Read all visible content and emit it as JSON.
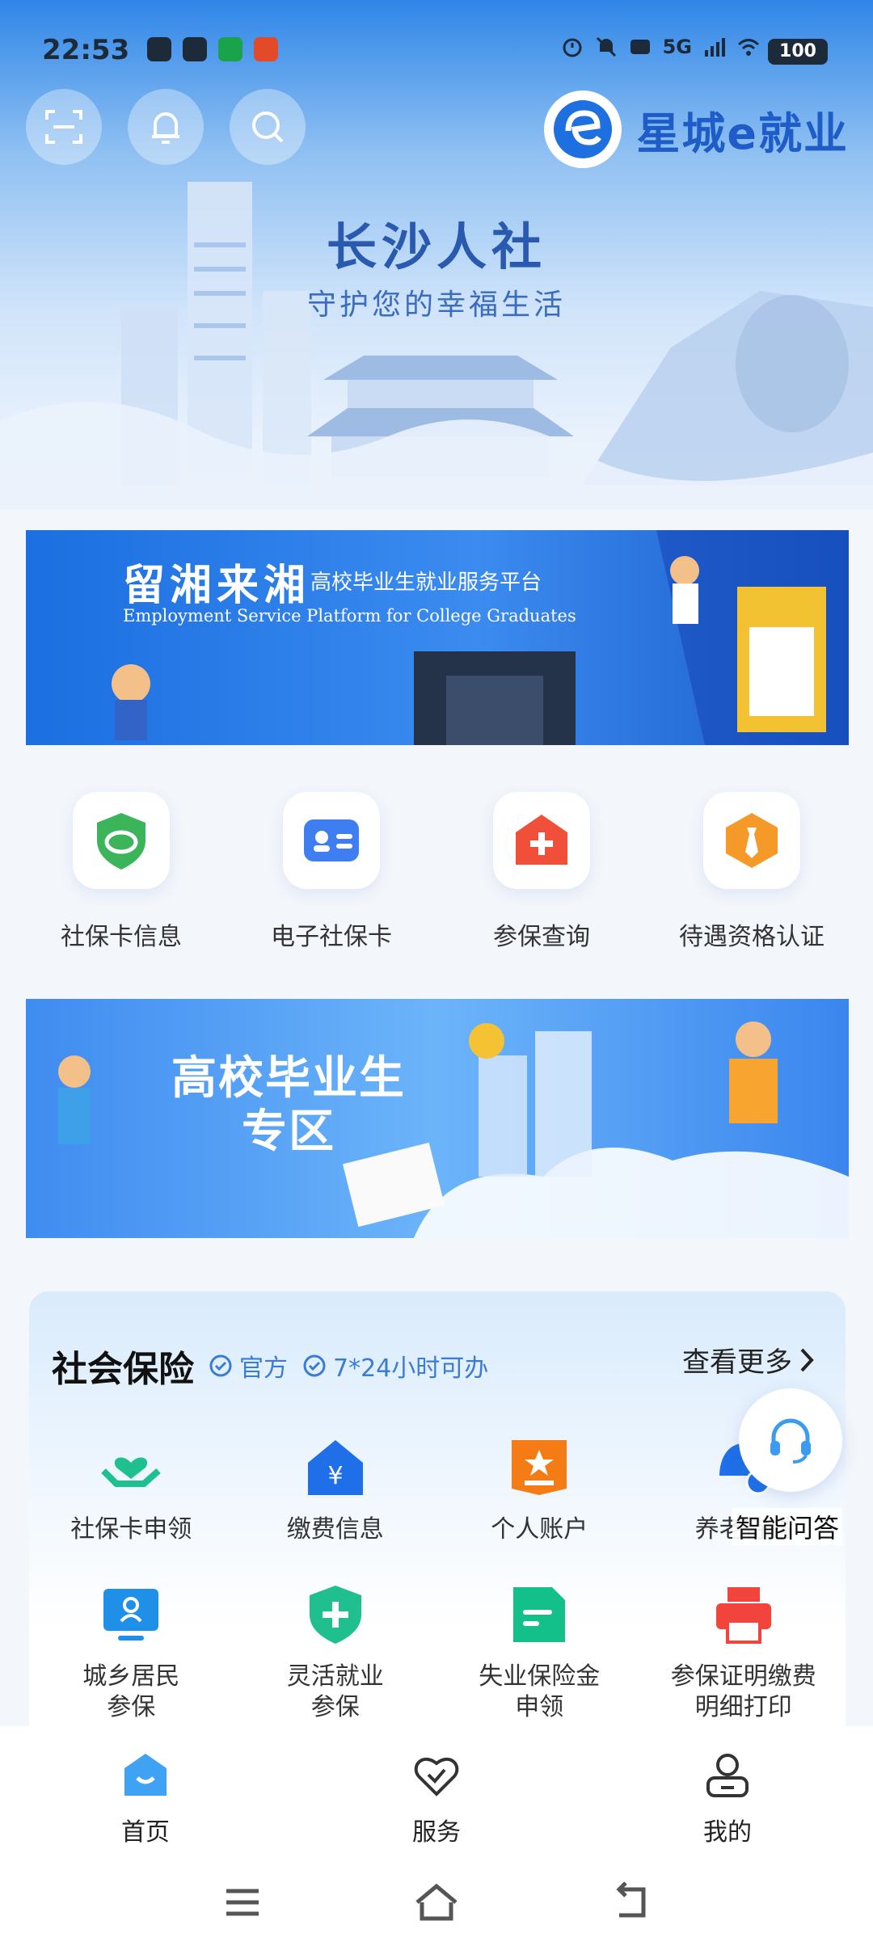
{
  "status_bar": {
    "time": "22:53",
    "network": "5G",
    "battery": "100",
    "icons": [
      "alarm-icon",
      "mute-icon",
      "hd-icon",
      "signal-icon",
      "wifi-icon"
    ]
  },
  "header": {
    "brand_name": "星城e就业",
    "title": "长沙人社",
    "subtitle": "守护您的幸福生活",
    "buttons": [
      "scan-icon",
      "bell-icon",
      "search-icon"
    ]
  },
  "banner_top": {
    "title": "留湘来湘",
    "title_suffix": "高校毕业生就业服务平台",
    "english": "Employment Service Platform for College Graduates"
  },
  "quick_actions": [
    {
      "label": "社保卡信息",
      "icon": "shield-card-icon",
      "color": "#3cb55a"
    },
    {
      "label": "电子社保卡",
      "icon": "id-card-icon",
      "color": "#3f7ef0"
    },
    {
      "label": "参保查询",
      "icon": "plus-house-icon",
      "color": "#f0503a"
    },
    {
      "label": "待遇资格认证",
      "icon": "tie-icon",
      "color": "#f59a28"
    }
  ],
  "banner_graduates": {
    "line1": "高校毕业生",
    "line2": "专区"
  },
  "social_insurance": {
    "title": "社会保险",
    "tag_official": "官方",
    "tag_hours": "7*24小时可办",
    "more": "查看更多",
    "items": [
      {
        "label": "社保卡申领",
        "icon": "heart-hands-icon",
        "color": "#1fbf8f"
      },
      {
        "label": "缴费信息",
        "icon": "yuan-house-icon",
        "color": "#1f6fe8"
      },
      {
        "label": "个人账户",
        "icon": "account-badge-icon",
        "color": "#f57c14"
      },
      {
        "label": "养老待遇",
        "icon": "pension-icon",
        "color": "#1f6fe8"
      },
      {
        "label": "城乡居民\n参保",
        "icon": "monitor-person-icon",
        "color": "#1f8fe8"
      },
      {
        "label": "灵活就业\n参保",
        "icon": "shield-plus-icon",
        "color": "#1fbf8f"
      },
      {
        "label": "失业保险金\n申领",
        "icon": "document-icon",
        "color": "#14c08a"
      },
      {
        "label": "参保证明缴费\n明细打印",
        "icon": "printer-icon",
        "color": "#f0443c"
      }
    ]
  },
  "assistant": {
    "label": "智能问答",
    "icon": "headset-icon"
  },
  "tab_bar": [
    {
      "label": "首页",
      "icon": "home-icon",
      "active": true
    },
    {
      "label": "服务",
      "icon": "heart-check-icon",
      "active": false
    },
    {
      "label": "我的",
      "icon": "user-icon",
      "active": false
    }
  ],
  "colors": {
    "primary": "#2f86e8",
    "accent_blue": "#3a7bd5"
  }
}
